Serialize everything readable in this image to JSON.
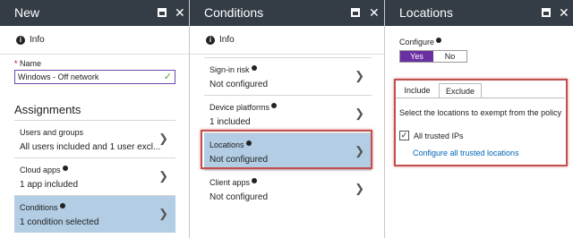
{
  "new_blade": {
    "title": "New",
    "info_label": "Info",
    "name_label": "Name",
    "name_required": "*",
    "name_value": "Windows - Off network",
    "assignments_heading": "Assignments",
    "items": [
      {
        "label": "Users and groups",
        "value": "All users included and 1 user excl..."
      },
      {
        "label": "Cloud apps",
        "value": "1 app included"
      },
      {
        "label": "Conditions",
        "value": "1 condition selected"
      }
    ]
  },
  "conditions_blade": {
    "title": "Conditions",
    "info_label": "Info",
    "items": [
      {
        "label": "Sign-in risk",
        "value": "Not configured"
      },
      {
        "label": "Device platforms",
        "value": "1 included"
      },
      {
        "label": "Locations",
        "value": "Not configured"
      },
      {
        "label": "Client apps",
        "value": "Not configured"
      }
    ]
  },
  "locations_blade": {
    "title": "Locations",
    "configure_label": "Configure",
    "toggle_yes": "Yes",
    "toggle_no": "No",
    "tab_include": "Include",
    "tab_exclude": "Exclude",
    "description": "Select the locations to exempt from the policy",
    "trusted_label": "All trusted IPs",
    "configure_link": "Configure all trusted locations"
  },
  "window_controls": {
    "maximize": "maximize-icon",
    "close": "close-icon",
    "close_glyph": "✕"
  },
  "colors": {
    "header": "#343c46",
    "selected": "#b3cde4",
    "highlight": "#c0504d",
    "toggle_on": "#6a2fa0"
  }
}
